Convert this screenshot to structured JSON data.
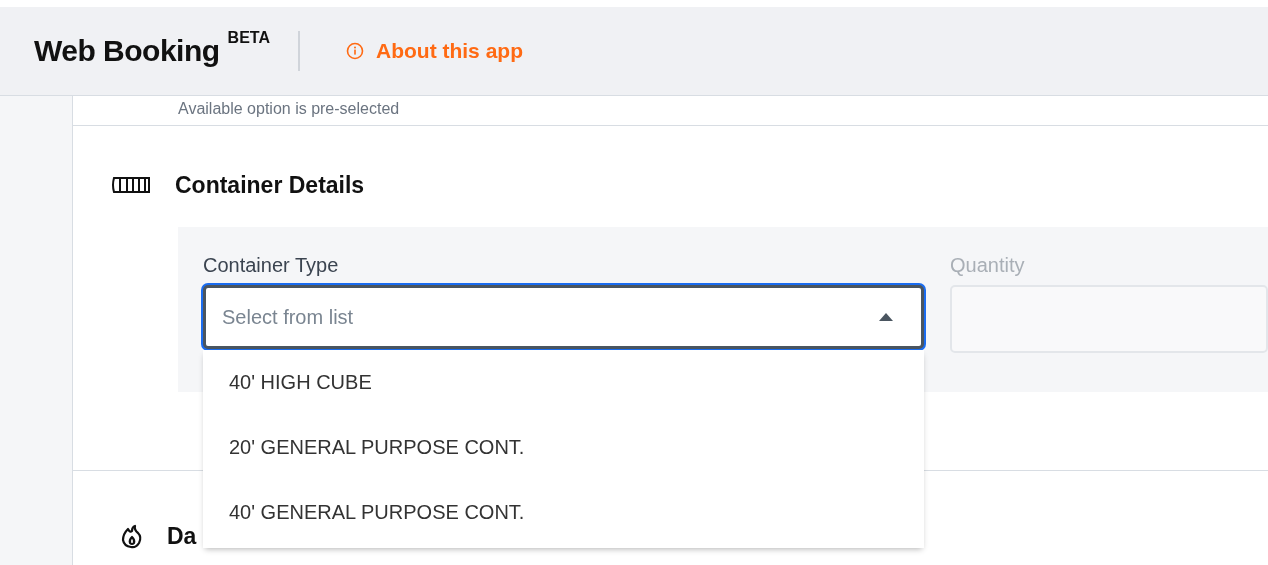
{
  "header": {
    "title": "Web Booking",
    "badge": "BETA",
    "about_link": "About this app"
  },
  "previous_section": {
    "hint": "Available option is pre-selected"
  },
  "container_details": {
    "title": "Container Details",
    "container_type": {
      "label": "Container Type",
      "placeholder": "Select from list",
      "expanded": true,
      "options": [
        {
          "label": "40' HIGH CUBE",
          "selected": false
        },
        {
          "label": "20' GENERAL PURPOSE CONT.",
          "selected": false
        },
        {
          "label": "40' GENERAL PURPOSE CONT.",
          "selected": false
        }
      ]
    },
    "quantity": {
      "label": "Quantity",
      "disabled": true
    }
  },
  "next_section": {
    "title": "Da"
  }
}
